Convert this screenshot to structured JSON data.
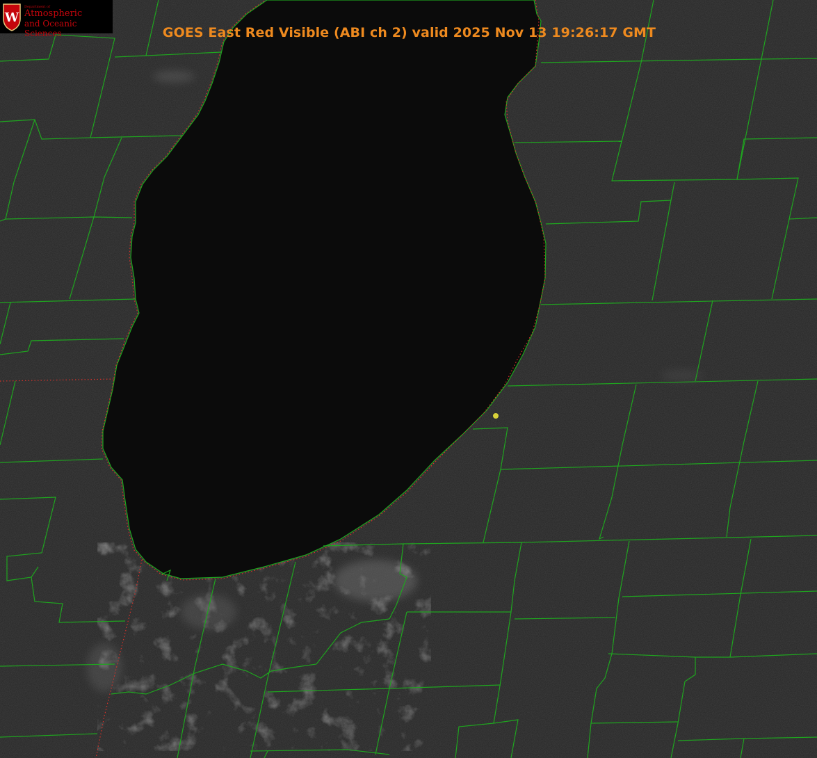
{
  "title": "GOES East Red Visible (ABI ch 2) valid 2025 Nov 13 19:26:17 GMT",
  "logo": {
    "department": "Department of",
    "line1": "Atmospheric",
    "line2": "and Oceanic Sciences",
    "emblem_letter": "W"
  },
  "colors": {
    "land": "#262626",
    "lake": "#0b0b0b",
    "county_border": "#1fa51f",
    "state_border_dotted": "#d8312a",
    "title": "#ee8a1f",
    "station_marker": "#d9d23a",
    "logo_red": "#c5050c"
  },
  "icons": {
    "logo": "uw-crest-icon",
    "marker": "station-dot-icon"
  }
}
